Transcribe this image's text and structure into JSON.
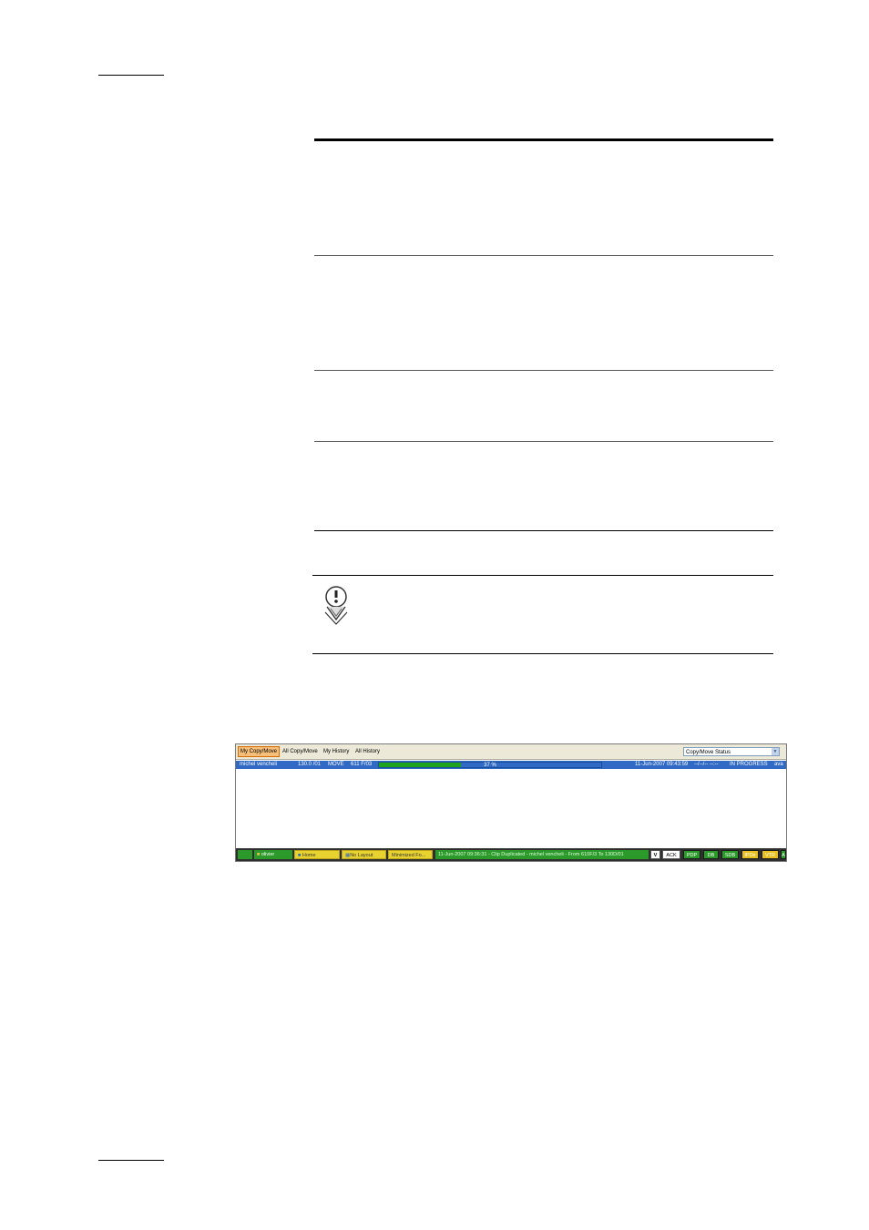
{
  "screenshot": {
    "tabs": [
      "My Copy/Move",
      "All Copy/Move",
      "My History",
      "All History"
    ],
    "active_tab": "My Copy/Move",
    "status_select": "Copy/Move Status",
    "row": {
      "user": "michel vencheli",
      "source": "130.0 /01",
      "operation": "MOVE",
      "destination": "611 F/03",
      "progress_percent": 37,
      "progress_label": "37 %",
      "date": "11-Jun-2007 09:43:59",
      "end": "--/--/-- --:--",
      "state": "IN PROGRESS",
      "extra": "ava"
    },
    "taskbar": {
      "user": "olivier",
      "home": "Home",
      "layout": "No Layout",
      "minimized": "Minimized Fo...",
      "message": "11-Jun-2007 09:36:31 - Clip Duplicated - michel vencheli - From 610F/3 To 130D/01",
      "v": "V",
      "ack": "ACK",
      "keys": [
        {
          "label": "PDP",
          "color": "#2b9a2b"
        },
        {
          "label": "DB",
          "color": "#2b9a2b"
        },
        {
          "label": "SDB",
          "color": "#2b9a2b"
        },
        {
          "label": "IPDir",
          "color": "#e8c020"
        },
        {
          "label": "VTR",
          "color": "#e8c020"
        },
        {
          "label": "A",
          "color": "#2b9a2b"
        }
      ]
    },
    "colors": {
      "selected_row": "#316ac5",
      "progress": "#1fa31f",
      "tab_active": "#f7c07a"
    }
  }
}
